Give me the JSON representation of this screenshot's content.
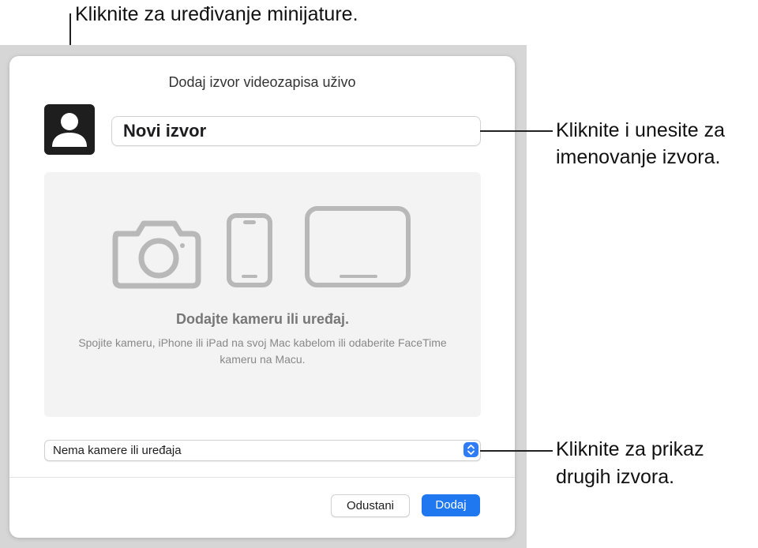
{
  "callouts": {
    "thumbnail": "Kliknite za uređivanje minijature.",
    "name_line1": "Kliknite i unesite za",
    "name_line2": "imenovanje izvora.",
    "popup_line1": "Kliknite za prikaz",
    "popup_line2": "drugih izvora."
  },
  "dialog": {
    "title": "Dodaj izvor videozapisa uživo",
    "name_value": "Novi izvor",
    "preview_title": "Dodajte kameru ili uređaj.",
    "preview_desc": "Spojite kameru, iPhone ili iPad na svoj Mac kabelom ili odaberite FaceTime kameru na Macu.",
    "source_select": "Nema kamere ili uređaja",
    "cancel_label": "Odustani",
    "add_label": "Dodaj"
  },
  "colors": {
    "accent": "#1f78f0",
    "icon_gray": "#b8b8b8"
  },
  "icons": [
    "person-icon",
    "camera-icon",
    "iphone-icon",
    "ipad-icon",
    "chevron-up-down-icon"
  ]
}
